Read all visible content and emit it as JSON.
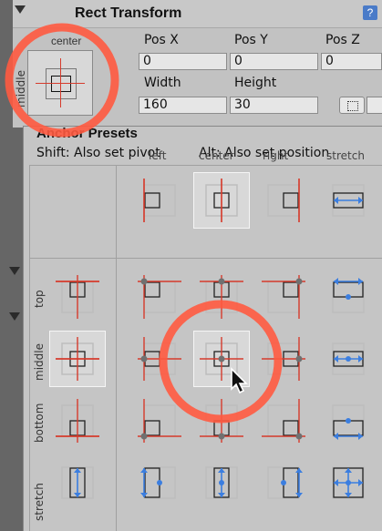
{
  "header": {
    "title": "Rect Transform",
    "help": "?"
  },
  "anchor_widget": {
    "corner_label": "center",
    "side_label": "middle"
  },
  "fields": {
    "pos_x_label": "Pos X",
    "pos_y_label": "Pos Y",
    "pos_z_label": "Pos Z",
    "pos_x": "0",
    "pos_y": "0",
    "pos_z": "0",
    "width_label": "Width",
    "height_label": "Height",
    "width": "160",
    "height": "30"
  },
  "presets": {
    "title": "Anchor Presets",
    "hint_shift": "Shift: Also set pivot",
    "hint_alt": "Alt: Also set position",
    "columns": [
      "left",
      "center",
      "right",
      "stretch"
    ],
    "rows": [
      "top",
      "middle",
      "bottom",
      "stretch"
    ]
  },
  "colors": {
    "panel": "#c3c3c3",
    "grid": "#bdbdbd",
    "anchor_red": "#d63b2c",
    "stretch_blue": "#3b7ee0",
    "highlight": "#ff5a40"
  }
}
